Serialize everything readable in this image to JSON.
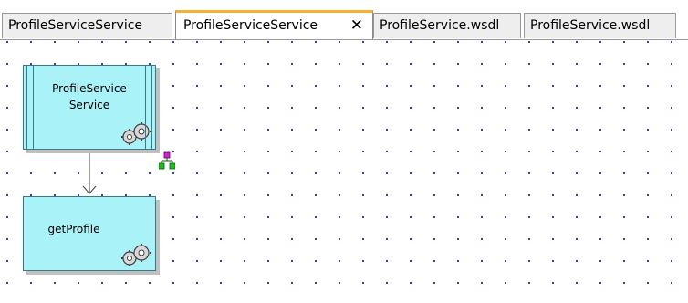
{
  "tabs": [
    {
      "label": "ProfileServiceService",
      "active": false
    },
    {
      "label": "ProfileServiceService",
      "active": true,
      "close_symbol": "✕"
    },
    {
      "label": "ProfileService.wsdl",
      "active": false
    },
    {
      "label": "ProfileService.wsdl",
      "active": false
    }
  ],
  "diagram": {
    "nodes": [
      {
        "id": "service",
        "label_line1": "ProfileService",
        "label_line2": "Service",
        "icon": "gears-icon"
      },
      {
        "id": "operation",
        "label": "getProfile",
        "icon": "gears-icon"
      }
    ],
    "connector_icon": "hierarchy-icon"
  },
  "colors": {
    "node_fill": "#a8f2f8",
    "node_border": "#3a7a88",
    "active_tab_accent": "#f4b030",
    "grid_dot": "#2a2aa0"
  }
}
